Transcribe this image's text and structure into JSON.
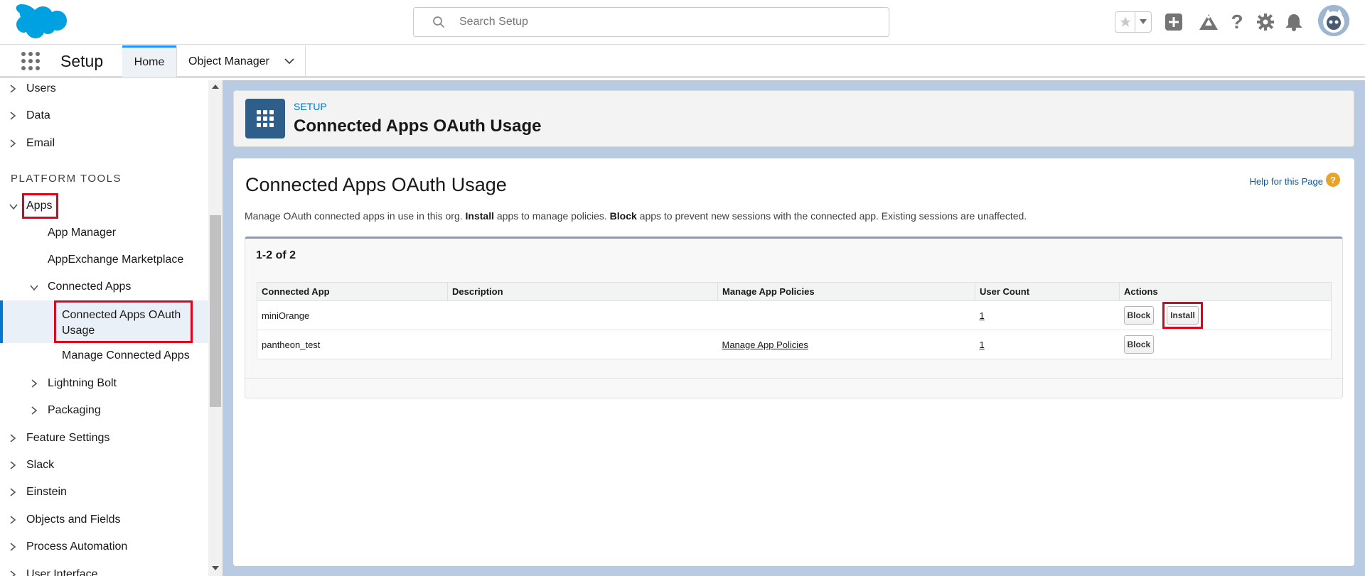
{
  "header": {
    "search_placeholder": "Search Setup",
    "icons": [
      "favorites-star-icon",
      "favorites-dropdown-icon",
      "add-icon",
      "trailhead-icon",
      "help-icon",
      "gear-icon",
      "notifications-bell-icon",
      "avatar"
    ]
  },
  "context_bar": {
    "app_name": "Setup",
    "tabs": [
      {
        "label": "Home",
        "active": true
      },
      {
        "label": "Object Manager",
        "has_dropdown": true
      }
    ]
  },
  "sidebar": {
    "items_top": [
      "Users",
      "Data",
      "Email"
    ],
    "section_label": "PLATFORM TOOLS",
    "apps_label": "Apps",
    "apps_children": [
      "App Manager",
      "AppExchange Marketplace"
    ],
    "connected_apps_label": "Connected Apps",
    "connected_children": [
      "Connected Apps OAuth Usage",
      "Manage Connected Apps"
    ],
    "apps_more": [
      "Lightning Bolt",
      "Packaging"
    ],
    "items_bottom": [
      "Feature Settings",
      "Slack",
      "Einstein",
      "Objects and Fields",
      "Process Automation",
      "User Interface"
    ]
  },
  "page_header": {
    "breadcrumb": "SETUP",
    "title": "Connected Apps OAuth Usage"
  },
  "content": {
    "title": "Connected Apps OAuth Usage",
    "help_link": "Help for this Page",
    "desc_part1": "Manage OAuth connected apps in use in this org. ",
    "desc_bold1": "Install",
    "desc_part2": " apps to manage policies. ",
    "desc_bold2": "Block",
    "desc_part3": " apps to prevent new sessions with the connected app. Existing sessions are unaffected.",
    "count": "1-2 of 2",
    "columns": [
      "Connected App",
      "Description",
      "Manage App Policies",
      "User Count",
      "Actions"
    ],
    "rows": [
      {
        "app": "miniOrange",
        "description": "",
        "policies": "",
        "user_count": "1",
        "block": "Block",
        "install": "Install"
      },
      {
        "app": "pantheon_test",
        "description": "",
        "policies": "Manage App Policies",
        "user_count": "1",
        "block": "Block"
      }
    ]
  },
  "colors": {
    "accent": "#0176d3",
    "highlight_box": "#e3001b",
    "brand_cloud": "#00a1e0",
    "background": "#b8cbe3"
  }
}
